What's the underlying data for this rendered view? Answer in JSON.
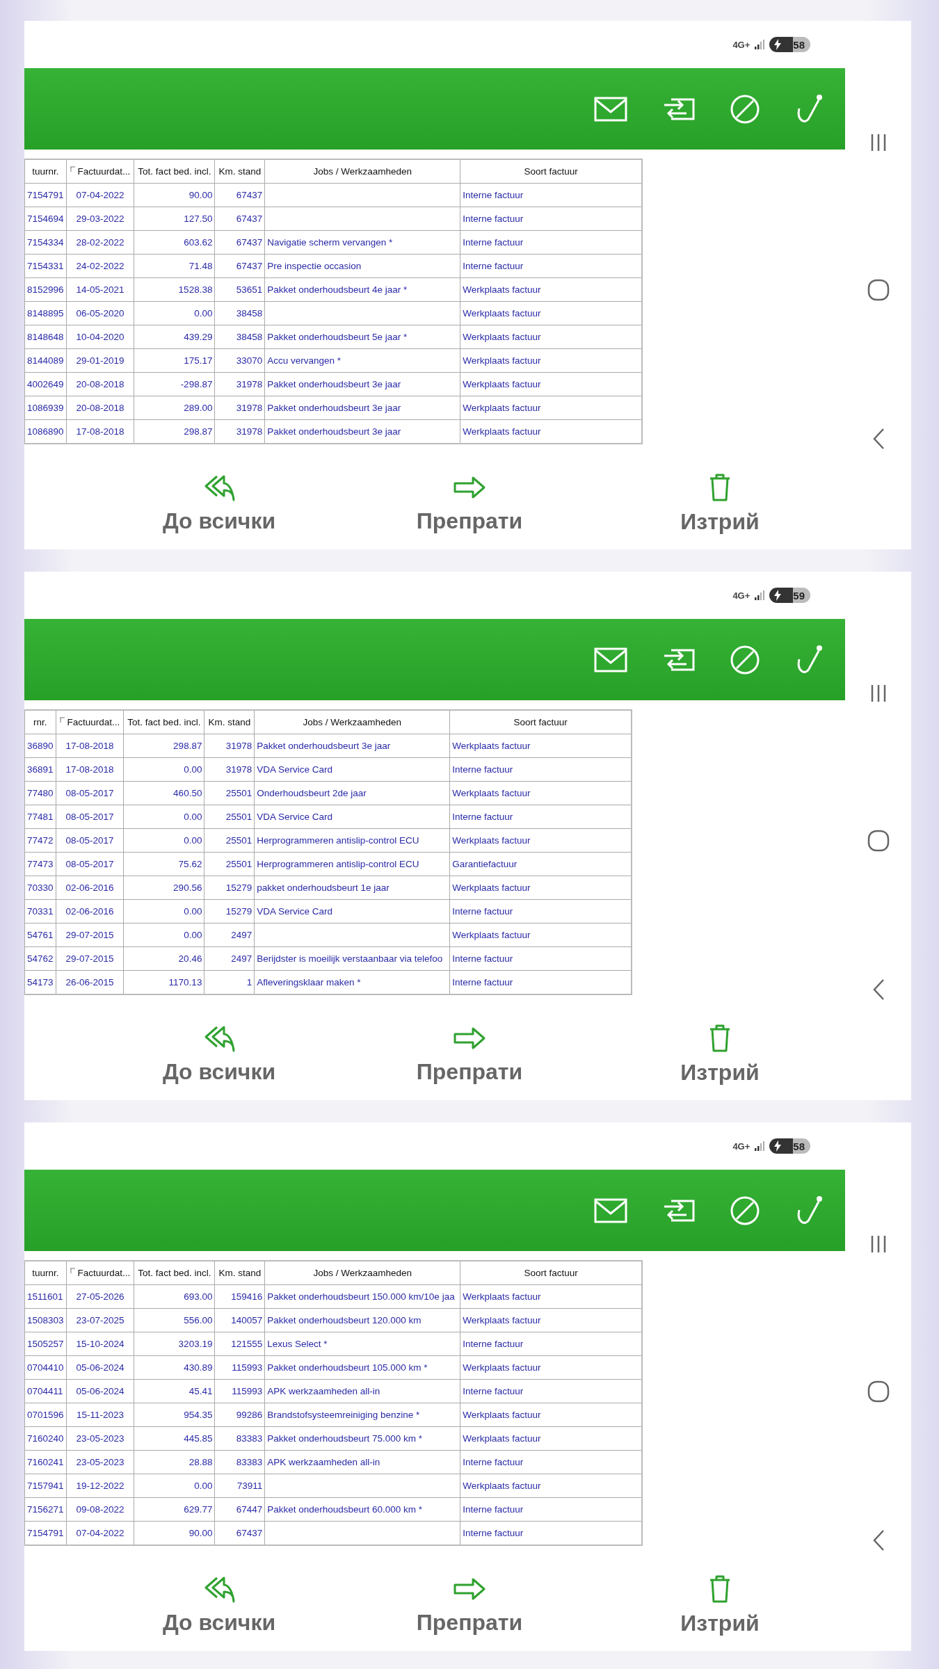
{
  "screens": [
    {
      "status_bar": {
        "network": "4G+",
        "battery": "58"
      },
      "table": {
        "columns": [
          {
            "label": "tuurnr.",
            "sorted": false
          },
          {
            "label": "Factuurdat...",
            "sorted": true
          },
          {
            "label": "Tot. fact bed. incl.",
            "sorted": false
          },
          {
            "label": "Km. stand",
            "sorted": false
          },
          {
            "label": "Jobs / Werkzaamheden",
            "sorted": false
          },
          {
            "label": "Soort factuur",
            "sorted": false
          }
        ],
        "rows": [
          {
            "number": "7154791",
            "date": "07-04-2022",
            "total": "90.00",
            "km": "67437",
            "type": "Interne factuur"
          },
          {
            "number": "7154694",
            "date": "29-03-2022",
            "total": "127.50",
            "km": "67437",
            "type": "Interne factuur"
          },
          {
            "number": "7154334",
            "date": "28-02-2022",
            "total": "603.62",
            "km": "67437",
            "jobs": "Navigatie scherm vervangen *",
            "type": "Interne factuur"
          },
          {
            "number": "7154331",
            "date": "24-02-2022",
            "total": "71.48",
            "km": "67437",
            "jobs": "Pre inspectie occasion",
            "type": "Interne factuur"
          },
          {
            "number": "8152996",
            "date": "14-05-2021",
            "total": "1528.38",
            "km": "53651",
            "jobs": "Pakket onderhoudsbeurt 4e jaar *",
            "type": "Werkplaats factuur"
          },
          {
            "number": "8148895",
            "date": "06-05-2020",
            "total": "0.00",
            "km": "38458",
            "type": "Werkplaats factuur"
          },
          {
            "number": "8148648",
            "date": "10-04-2020",
            "total": "439.29",
            "km": "38458",
            "jobs": "Pakket onderhoudsbeurt 5e jaar *",
            "type": "Werkplaats factuur"
          },
          {
            "number": "8144089",
            "date": "29-01-2019",
            "total": "175.17",
            "km": "33070",
            "jobs": "Accu vervangen *",
            "type": "Werkplaats factuur"
          },
          {
            "number": "4002649",
            "date": "20-08-2018",
            "total": "-298.87",
            "km": "31978",
            "jobs": "Pakket onderhoudsbeurt 3e jaar",
            "type": "Werkplaats factuur"
          },
          {
            "number": "1086939",
            "date": "20-08-2018",
            "total": "289.00",
            "km": "31978",
            "jobs": "Pakket onderhoudsbeurt 3e jaar",
            "type": "Werkplaats factuur"
          },
          {
            "number": "1086890",
            "date": "17-08-2018",
            "total": "298.87",
            "km": "31978",
            "jobs": "Pakket onderhoudsbeurt 3e jaar",
            "type": "Werkplaats factuur"
          }
        ]
      },
      "actions": [
        {
          "label": "До всички",
          "kind": "reply-all"
        },
        {
          "label": "Препрати",
          "kind": "forward"
        },
        {
          "label": "Изтрий",
          "kind": "delete"
        }
      ]
    },
    {
      "status_bar": {
        "network": "4G+",
        "battery": "59"
      },
      "table": {
        "columns": [
          {
            "label": "rnr.",
            "sorted": false
          },
          {
            "label": "Factuurdat...",
            "sorted": true
          },
          {
            "label": "Tot. fact bed. incl.",
            "sorted": false
          },
          {
            "label": "Km. stand",
            "sorted": false
          },
          {
            "label": "Jobs / Werkzaamheden",
            "sorted": false
          },
          {
            "label": "Soort factuur",
            "sorted": false
          }
        ],
        "rows": [
          {
            "number": "36890",
            "date": "17-08-2018",
            "total": "298.87",
            "km": "31978",
            "jobs": "Pakket onderhoudsbeurt 3e jaar",
            "type": "Werkplaats factuur"
          },
          {
            "number": "36891",
            "date": "17-08-2018",
            "total": "0.00",
            "km": "31978",
            "jobs": "VDA Service Card",
            "type": "Interne factuur"
          },
          {
            "number": "77480",
            "date": "08-05-2017",
            "total": "460.50",
            "km": "25501",
            "jobs": "Onderhoudsbeurt 2de jaar",
            "type": "Werkplaats factuur"
          },
          {
            "number": "77481",
            "date": "08-05-2017",
            "total": "0.00",
            "km": "25501",
            "jobs": "VDA Service Card",
            "type": "Interne factuur"
          },
          {
            "number": "77472",
            "date": "08-05-2017",
            "total": "0.00",
            "km": "25501",
            "jobs": "Herprogrammeren antislip-control ECU",
            "type": "Werkplaats factuur"
          },
          {
            "number": "77473",
            "date": "08-05-2017",
            "total": "75.62",
            "km": "25501",
            "jobs": "Herprogrammeren antislip-control ECU",
            "type": "Garantiefactuur"
          },
          {
            "number": "70330",
            "date": "02-06-2016",
            "total": "290.56",
            "km": "15279",
            "jobs": "pakket onderhoudsbeurt 1e jaar",
            "type": "Werkplaats factuur"
          },
          {
            "number": "70331",
            "date": "02-06-2016",
            "total": "0.00",
            "km": "15279",
            "jobs": "VDA Service Card",
            "type": "Interne factuur"
          },
          {
            "number": "54761",
            "date": "29-07-2015",
            "total": "0.00",
            "km": "2497",
            "type": "Werkplaats factuur"
          },
          {
            "number": "54762",
            "date": "29-07-2015",
            "total": "20.46",
            "km": "2497",
            "jobs": "Berijdster is moeilijk verstaanbaar via telefoo",
            "type": "Interne factuur"
          },
          {
            "number": "54173",
            "date": "26-06-2015",
            "total": "1170.13",
            "km": "1",
            "jobs": "Afleveringsklaar maken *",
            "type": "Interne factuur"
          }
        ]
      },
      "actions": [
        {
          "label": "До всички",
          "kind": "reply-all"
        },
        {
          "label": "Препрати",
          "kind": "forward"
        },
        {
          "label": "Изтрий",
          "kind": "delete"
        }
      ]
    },
    {
      "status_bar": {
        "network": "4G+",
        "battery": "58"
      },
      "table": {
        "columns": [
          {
            "label": "tuurnr.",
            "sorted": false
          },
          {
            "label": "Factuurdat...",
            "sorted": true
          },
          {
            "label": "Tot. fact bed. incl.",
            "sorted": false
          },
          {
            "label": "Km. stand",
            "sorted": false
          },
          {
            "label": "Jobs / Werkzaamheden",
            "sorted": false
          },
          {
            "label": "Soort factuur",
            "sorted": false
          }
        ],
        "rows": [
          {
            "number": "1511601",
            "date": "27-05-2026",
            "total": "693.00",
            "km": "159416",
            "jobs": "Pakket onderhoudsbeurt 150.000 km/10e jaa",
            "type": "Werkplaats factuur"
          },
          {
            "number": "1508303",
            "date": "23-07-2025",
            "total": "556.00",
            "km": "140057",
            "jobs": "Pakket onderhoudsbeurt 120.000 km",
            "type": "Werkplaats factuur"
          },
          {
            "number": "1505257",
            "date": "15-10-2024",
            "total": "3203.19",
            "km": "121555",
            "jobs": "Lexus Select *",
            "type": "Interne factuur"
          },
          {
            "number": "0704410",
            "date": "05-06-2024",
            "total": "430.89",
            "km": "115993",
            "jobs": "Pakket onderhoudsbeurt 105.000 km *",
            "type": "Werkplaats factuur"
          },
          {
            "number": "0704411",
            "date": "05-06-2024",
            "total": "45.41",
            "km": "115993",
            "jobs": "APK werkzaamheden all-in",
            "type": "Interne factuur"
          },
          {
            "number": "0701596",
            "date": "15-11-2023",
            "total": "954.35",
            "km": "99286",
            "jobs": "Brandstofsysteemreiniging benzine *",
            "type": "Werkplaats factuur"
          },
          {
            "number": "7160240",
            "date": "23-05-2023",
            "total": "445.85",
            "km": "83383",
            "jobs": "Pakket onderhoudsbeurt 75.000 km *",
            "type": "Werkplaats factuur"
          },
          {
            "number": "7160241",
            "date": "23-05-2023",
            "total": "28.88",
            "km": "83383",
            "jobs": "APK werkzaamheden all-in",
            "type": "Interne factuur"
          },
          {
            "number": "7157941",
            "date": "19-12-2022",
            "total": "0.00",
            "km": "73911",
            "type": "Werkplaats factuur"
          },
          {
            "number": "7156271",
            "date": "09-08-2022",
            "total": "629.77",
            "km": "67447",
            "jobs": "Pakket onderhoudsbeurt 60.000 km *",
            "type": "Interne factuur"
          },
          {
            "number": "7154791",
            "date": "07-04-2022",
            "total": "90.00",
            "km": "67437",
            "type": "Interne factuur"
          }
        ]
      },
      "actions": [
        {
          "label": "До всички",
          "kind": "reply-all"
        },
        {
          "label": "Препрати",
          "kind": "forward"
        },
        {
          "label": "Изтрий",
          "kind": "delete"
        }
      ]
    }
  ]
}
